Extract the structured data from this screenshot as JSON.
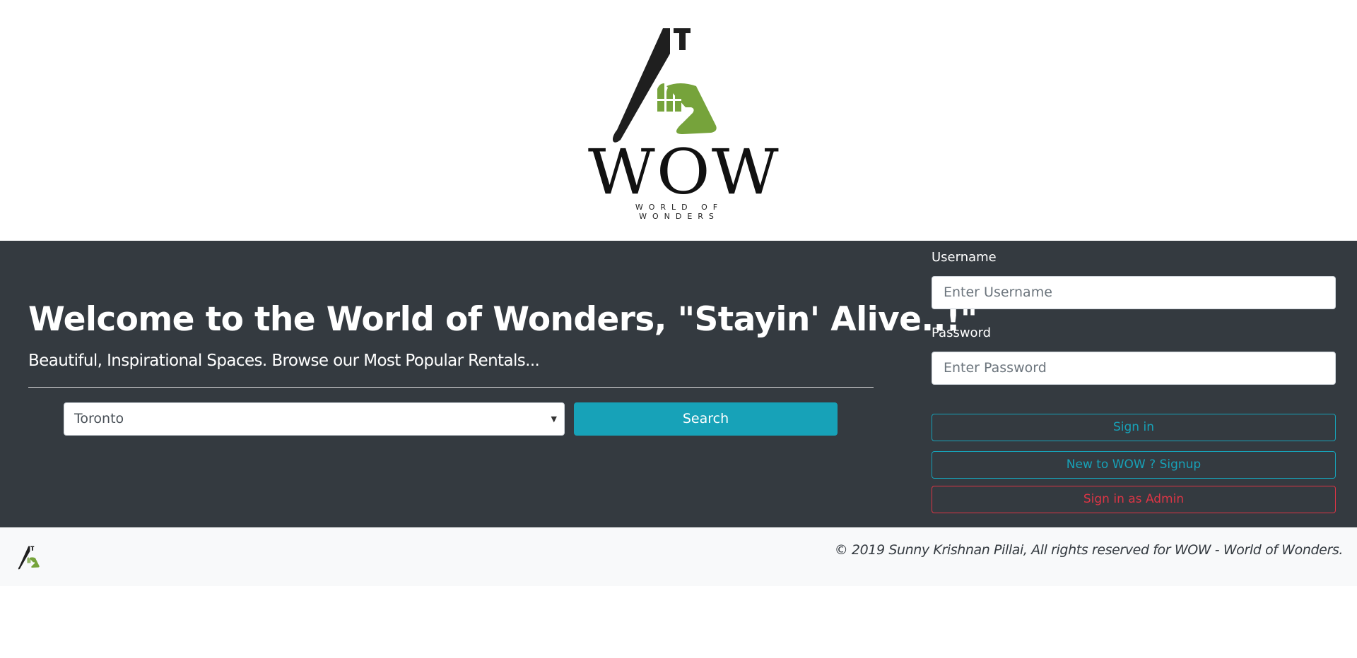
{
  "brand": {
    "logo_word": "WOW",
    "logo_tagline": "WORLD OF WONDERS",
    "colors": {
      "dark": "#1f1f1f",
      "green": "#76a33b"
    }
  },
  "hero": {
    "title": "Welcome to the World of Wonders, \"Stayin' Alive..!\"",
    "subtitle": "Beautiful, Inspirational Spaces. Browse our Most Popular Rentals...",
    "city_select": {
      "value": "Toronto"
    },
    "search_label": "Search",
    "colors": {
      "background": "#343a40",
      "accent": "#17a2b8"
    }
  },
  "login": {
    "username_label": "Username",
    "username_placeholder": "Enter Username",
    "password_label": "Password",
    "password_placeholder": "Enter Password",
    "signin_label": "Sign in",
    "signup_label": "New to WOW ? Signup",
    "admin_label": "Sign in as Admin",
    "colors": {
      "info": "#17a2b8",
      "danger": "#dc3545"
    }
  },
  "footer": {
    "copyright": "© 2019 Sunny Krishnan Pillai, All rights reserved for WOW - World of Wonders."
  }
}
